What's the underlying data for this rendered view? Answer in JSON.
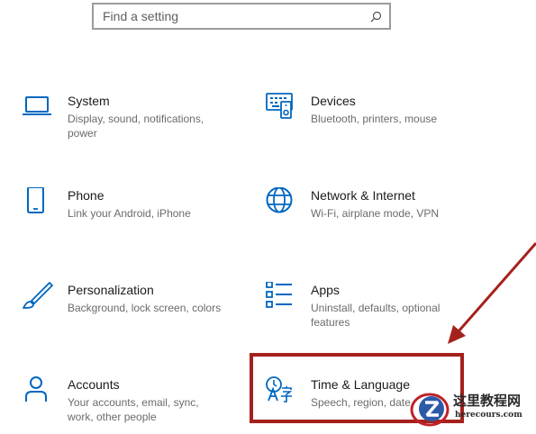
{
  "search": {
    "placeholder": "Find a setting",
    "icon": "search-icon"
  },
  "accent_color": "#0067c0",
  "highlight_color": "#a5211c",
  "tiles": [
    {
      "icon": "laptop-icon",
      "title": "System",
      "description": "Display, sound, notifications, power"
    },
    {
      "icon": "devices-icon",
      "title": "Devices",
      "description": "Bluetooth, printers, mouse"
    },
    {
      "icon": "phone-icon",
      "title": "Phone",
      "description": "Link your Android, iPhone"
    },
    {
      "icon": "globe-icon",
      "title": "Network & Internet",
      "description": "Wi-Fi, airplane mode, VPN"
    },
    {
      "icon": "paintbrush-icon",
      "title": "Personalization",
      "description": "Background, lock screen, colors"
    },
    {
      "icon": "apps-list-icon",
      "title": "Apps",
      "description": "Uninstall, defaults, optional features"
    },
    {
      "icon": "person-icon",
      "title": "Accounts",
      "description": "Your accounts, email, sync, work, other people"
    },
    {
      "icon": "time-language-icon",
      "title": "Time & Language",
      "description": "Speech, region, date"
    }
  ],
  "watermark": {
    "title": "这里教程网",
    "url": "herecours.com"
  }
}
